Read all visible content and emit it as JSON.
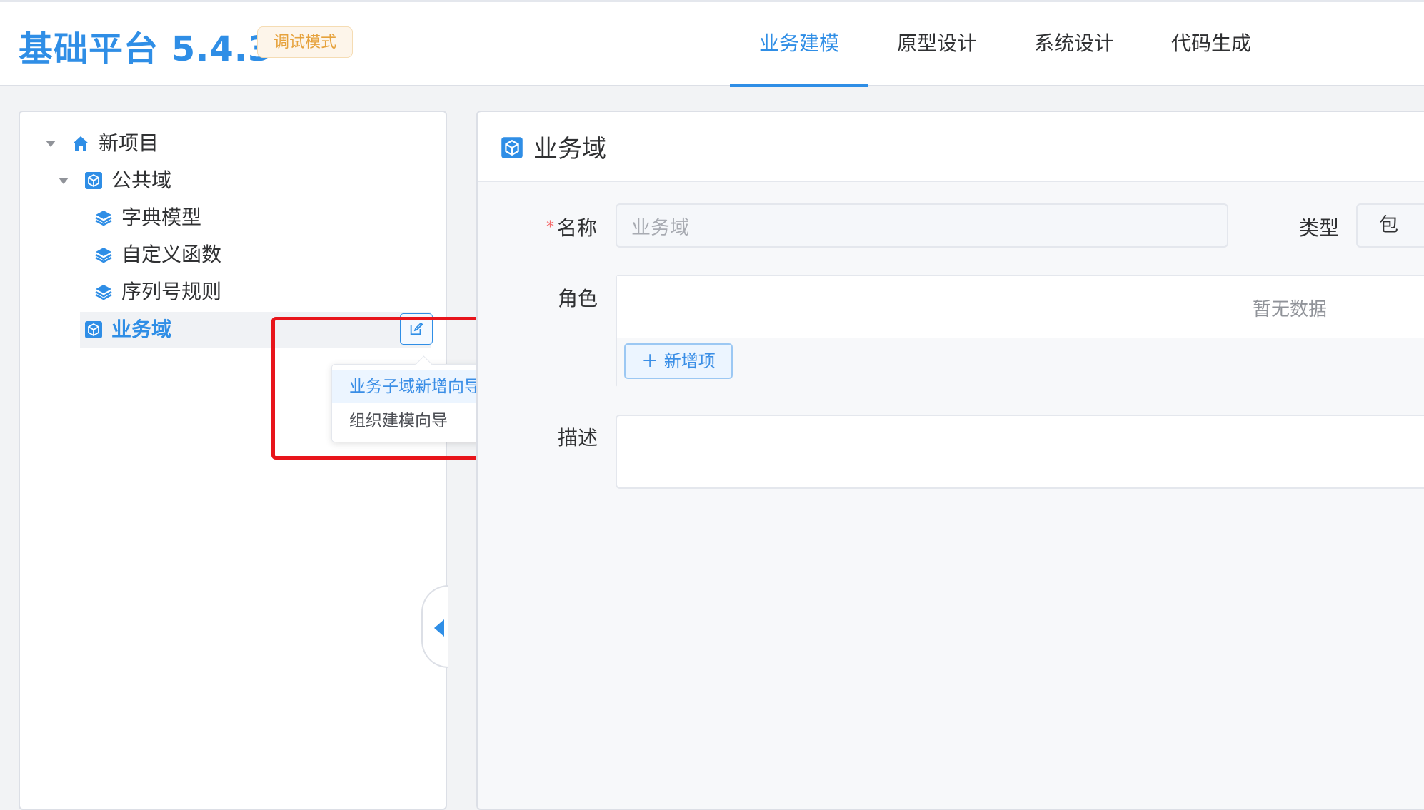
{
  "header": {
    "app_title": "基础平台 5.4.3",
    "mode_badge": "调试模式",
    "tabs": [
      {
        "label": "业务建模",
        "active": true
      },
      {
        "label": "原型设计",
        "active": false
      },
      {
        "label": "系统设计",
        "active": false
      },
      {
        "label": "代码生成",
        "active": false
      }
    ]
  },
  "tree": {
    "items": [
      {
        "label": "新项目",
        "icon": "home-icon",
        "level": 0,
        "expanded": true
      },
      {
        "label": "公共域",
        "icon": "domain-cube-icon",
        "level": 1,
        "expanded": true
      },
      {
        "label": "字典模型",
        "icon": "layers-icon",
        "level": 2
      },
      {
        "label": "自定义函数",
        "icon": "layers-icon",
        "level": 2
      },
      {
        "label": "序列号规则",
        "icon": "layers-icon",
        "level": 2
      },
      {
        "label": "业务域",
        "icon": "domain-cube-icon",
        "level": 1,
        "selected": true
      }
    ],
    "context_menu": {
      "items": [
        {
          "label": "业务子域新增向导",
          "hovered": true
        },
        {
          "label": "组织建模向导",
          "hovered": false
        }
      ]
    }
  },
  "detail": {
    "title": "业务域",
    "icon": "domain-cube-icon",
    "name_label": "名称",
    "name_required_mark": "*",
    "name_value": "业务域",
    "type_label": "类型",
    "type_value": "包",
    "role_label": "角色",
    "role_empty_text": "暂无数据",
    "add_item_label": "＋ 新增项",
    "description_label": "描述",
    "description_value": ""
  },
  "colors": {
    "accent": "#2f8ee6",
    "badge_text": "#e6a23c",
    "highlight_box": "#e8151b",
    "required": "#f56c6c"
  }
}
